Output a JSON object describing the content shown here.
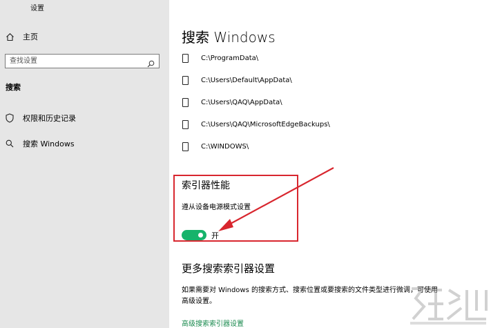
{
  "app": {
    "title": "设置"
  },
  "sidebar": {
    "home_label": "主页",
    "search_placeholder": "查找设置",
    "section_heading": "搜索",
    "items": [
      {
        "label": "权限和历史记录",
        "icon": "shield-icon"
      },
      {
        "label": "搜索 Windows",
        "icon": "search-icon"
      }
    ]
  },
  "main": {
    "title": "搜索 Windows",
    "excluded_folders": [
      "C:\\ProgramData\\",
      "C:\\Users\\Default\\AppData\\",
      "C:\\Users\\QAQ\\AppData\\",
      "C:\\Users\\QAQ\\MicrosoftEdgeBackups\\",
      "C:\\WINDOWS\\"
    ],
    "indexer_performance": {
      "title": "索引器性能",
      "description": "遵从设备电源模式设置",
      "toggle_on": true,
      "toggle_state_label": "开"
    },
    "more_settings": {
      "title": "更多搜索索引器设置",
      "description": "如果需要对 Windows 的搜索方式、搜索位置或要搜索的文件类型进行微调，可使用高级设置。",
      "advanced_link": "高级搜索索引器设置"
    }
  },
  "colors": {
    "sidebar_bg": "#e6e6e6",
    "toggle_on": "#16b36b",
    "link": "#1a8a4e",
    "annotation": "#d8262e"
  }
}
